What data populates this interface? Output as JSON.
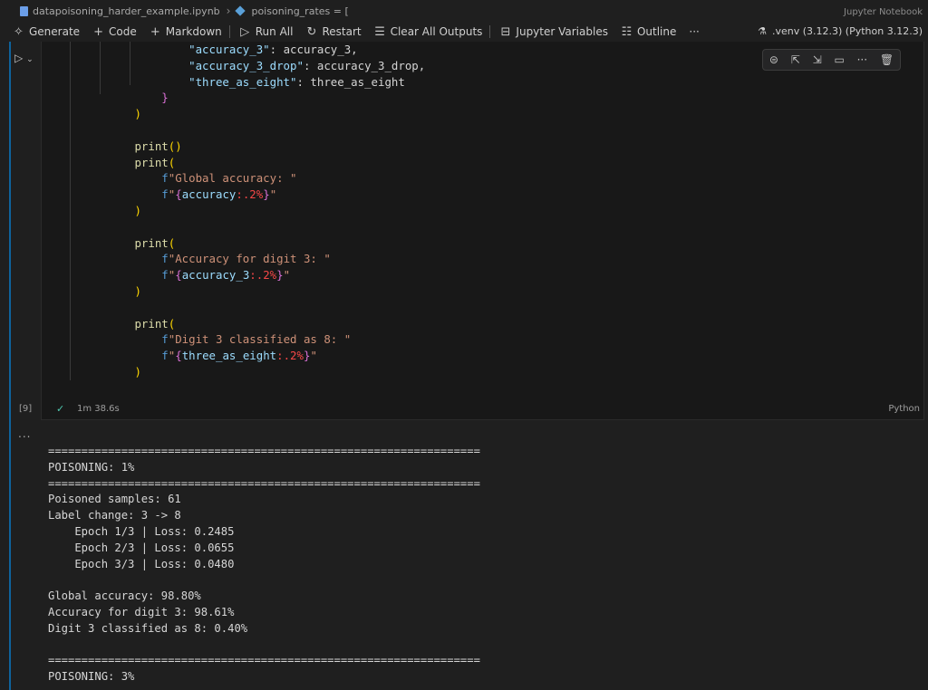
{
  "breadcrumb": {
    "file": "datapoisoning_harder_example.ipynb",
    "symbol": "poisoning_rates = [",
    "editor_label": "Jupyter Notebook"
  },
  "toolbar": {
    "generate": "Generate",
    "code": "Code",
    "markdown": "Markdown",
    "run_all": "Run All",
    "restart": "Restart",
    "clear_outputs": "Clear All Outputs",
    "variables": "Jupyter Variables",
    "outline": "Outline",
    "more": "···",
    "kernel": ".venv (3.12.3) (Python 3.12.3)"
  },
  "cell": {
    "execution_count": "[9]",
    "duration": "1m 38.6s",
    "language": "Python"
  },
  "code_lines": [
    [
      [
        "t-key",
        "\"accuracy_3\""
      ],
      [
        "t-def",
        ": accuracy_3,"
      ]
    ],
    [
      [
        "t-key",
        "\"accuracy_3_drop\""
      ],
      [
        "t-def",
        ": accuracy_3_drop,"
      ]
    ],
    [
      [
        "t-key",
        "\"three_as_eight\""
      ],
      [
        "t-def",
        ": three_as_eight"
      ]
    ],
    [
      [
        "t-p2",
        "}"
      ]
    ],
    [
      [
        "t-p1",
        ")"
      ]
    ],
    [],
    [
      [
        "t-fn",
        "print"
      ],
      [
        "t-p1",
        "()"
      ]
    ],
    [
      [
        "t-fn",
        "print"
      ],
      [
        "t-p1",
        "("
      ]
    ],
    [
      [
        "t-fpre",
        "f"
      ],
      [
        "t-str",
        "\"Global accuracy: \""
      ]
    ],
    [
      [
        "t-fpre",
        "f"
      ],
      [
        "t-str",
        "\""
      ],
      [
        "t-p2",
        "{"
      ],
      [
        "t-key",
        "accuracy"
      ],
      [
        "t-fmt",
        ":.2%"
      ],
      [
        "t-p2",
        "}"
      ],
      [
        "t-str",
        "\""
      ]
    ],
    [
      [
        "t-p1",
        ")"
      ]
    ],
    [],
    [
      [
        "t-fn",
        "print"
      ],
      [
        "t-p1",
        "("
      ]
    ],
    [
      [
        "t-fpre",
        "f"
      ],
      [
        "t-str",
        "\"Accuracy for digit 3: \""
      ]
    ],
    [
      [
        "t-fpre",
        "f"
      ],
      [
        "t-str",
        "\""
      ],
      [
        "t-p2",
        "{"
      ],
      [
        "t-key",
        "accuracy_3"
      ],
      [
        "t-fmt",
        ":.2%"
      ],
      [
        "t-p2",
        "}"
      ],
      [
        "t-str",
        "\""
      ]
    ],
    [
      [
        "t-p1",
        ")"
      ]
    ],
    [],
    [
      [
        "t-fn",
        "print"
      ],
      [
        "t-p1",
        "("
      ]
    ],
    [
      [
        "t-fpre",
        "f"
      ],
      [
        "t-str",
        "\"Digit 3 classified as 8: \""
      ]
    ],
    [
      [
        "t-fpre",
        "f"
      ],
      [
        "t-str",
        "\""
      ],
      [
        "t-p2",
        "{"
      ],
      [
        "t-key",
        "three_as_eight"
      ],
      [
        "t-fmt",
        ":.2%"
      ],
      [
        "t-p2",
        "}"
      ],
      [
        "t-str",
        "\""
      ]
    ],
    [
      [
        "t-p1",
        ")"
      ]
    ]
  ],
  "output_dots": "...",
  "output_lines": [
    "=================================================================",
    "POISONING: 1%",
    "=================================================================",
    "Poisoned samples: 61",
    "Label change: 3 -> 8",
    "    Epoch 1/3 | Loss: 0.2485",
    "    Epoch 2/3 | Loss: 0.0655",
    "    Epoch 3/3 | Loss: 0.0480",
    "",
    "Global accuracy: 98.80%",
    "Accuracy for digit 3: 98.61%",
    "Digit 3 classified as 8: 0.40%",
    "",
    "=================================================================",
    "POISONING: 3%"
  ],
  "icons": {
    "generate": "sparkle-icon",
    "code": "plus-icon",
    "markdown": "plus-icon",
    "run_all": "run-all-icon",
    "restart": "restart-icon",
    "clear": "clear-outputs-icon",
    "variables": "variables-icon",
    "outline": "outline-icon"
  },
  "colors": {
    "accent": "#0e639c",
    "success": "#4ec9b0"
  }
}
